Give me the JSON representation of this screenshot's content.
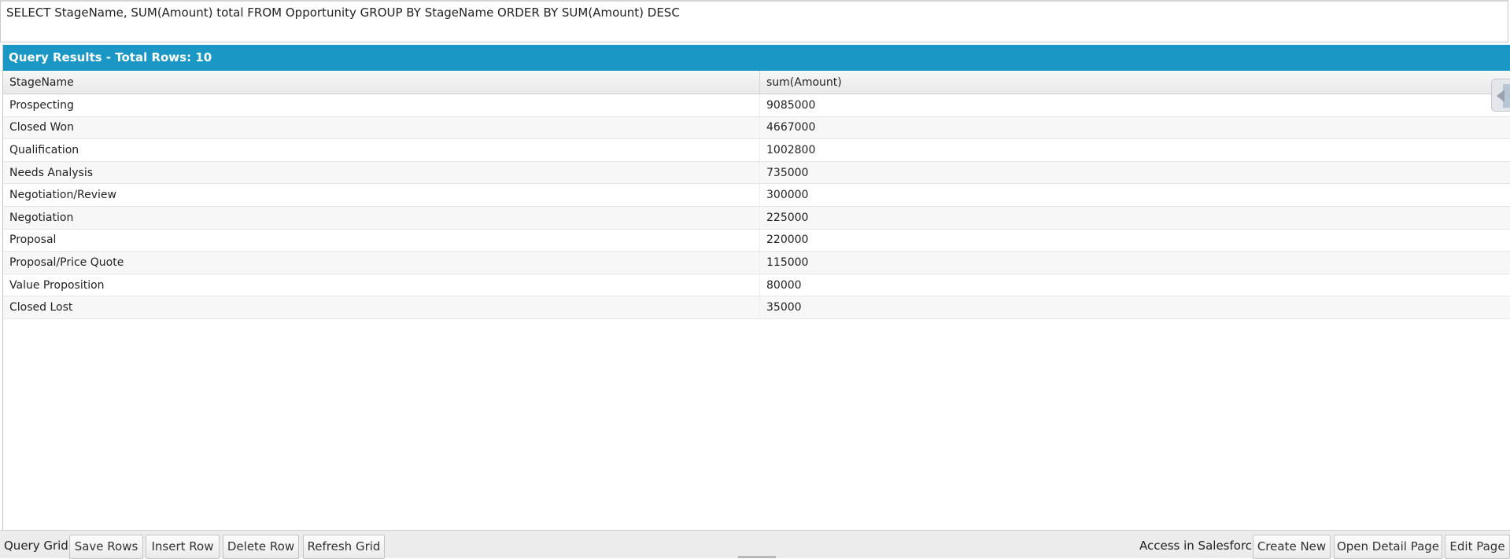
{
  "query": {
    "text": "SELECT StageName, SUM(Amount) total FROM Opportunity GROUP BY StageName ORDER BY SUM(Amount) DESC"
  },
  "results": {
    "header": "Query Results - Total Rows: 10",
    "columns": [
      "StageName",
      "sum(Amount)"
    ],
    "rows": [
      [
        "Prospecting",
        "9085000"
      ],
      [
        "Closed Won",
        "4667000"
      ],
      [
        "Qualification",
        "1002800"
      ],
      [
        "Needs Analysis",
        "735000"
      ],
      [
        "Negotiation/Review",
        "300000"
      ],
      [
        "Negotiation",
        "225000"
      ],
      [
        "Proposal",
        "220000"
      ],
      [
        "Proposal/Price Quote",
        "115000"
      ],
      [
        "Value Proposition",
        "80000"
      ],
      [
        "Closed Lost",
        "35000"
      ]
    ]
  },
  "toolbar": {
    "query_grid_label": "Query Grid:",
    "save_rows": "Save Rows",
    "insert_row": "Insert Row",
    "delete_row": "Delete Row",
    "refresh_grid": "Refresh Grid",
    "access_label": "Access in Salesforce:",
    "create_new": "Create New",
    "open_detail_page": "Open Detail Page",
    "edit_page": "Edit Page"
  },
  "colors": {
    "header_bg": "#1b97c5",
    "toolbar_bg": "#ececec"
  },
  "icons": {
    "side_panel_toggle": "collapse-arrow-icon"
  }
}
